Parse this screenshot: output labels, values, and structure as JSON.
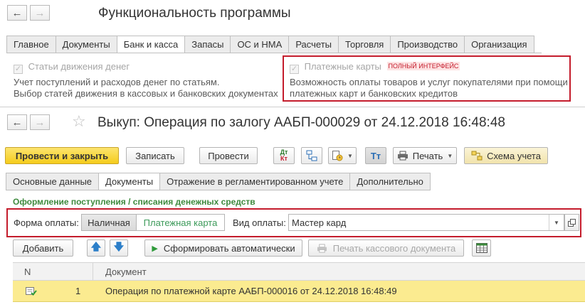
{
  "top_window": {
    "title": "Функциональность программы",
    "tabs": [
      "Главное",
      "Документы",
      "Банк и касса",
      "Запасы",
      "ОС и НМА",
      "Расчеты",
      "Торговля",
      "Производство",
      "Организация"
    ],
    "active_tab": "Банк и касса",
    "option_left": {
      "label": "Статьи движения денег",
      "checked": true,
      "desc_line1": "Учет поступлений и расходов денег по статьям.",
      "desc_line2": "Выбор статей движения в кассовых и банковских документах"
    },
    "option_right": {
      "label": "Платежные карты",
      "checked": true,
      "badge": "ПОЛНЫЙ ИНТЕРФЕЙС",
      "desc_line1": "Возможность оплаты товаров и услуг покупателями при помощи",
      "desc_line2": "платежных карт и банковских кредитов"
    }
  },
  "doc_window": {
    "title": "Выкуп: Операция по залогу ААБП-000029 от 24.12.2018 16:48:48",
    "toolbar": {
      "post_close": "Провести и закрыть",
      "save": "Записать",
      "post": "Провести",
      "dtkt_top": "Дт",
      "dtkt_bottom": "Кт",
      "print": "Печать",
      "schema": "Схема учета"
    },
    "tabs": [
      "Основные данные",
      "Документы",
      "Отражение в регламентированном учете",
      "Дополнительно"
    ],
    "active_tab": "Документы",
    "section_title": "Оформление поступления / списания денежных средств",
    "payment_form_label": "Форма оплаты:",
    "payment_form_options": [
      "Наличная",
      "Платежная карта"
    ],
    "payment_form_selected": "Платежная карта",
    "payment_type_label": "Вид оплаты:",
    "payment_type_value": "Мастер кард",
    "table_toolbar": {
      "add": "Добавить",
      "auto": "Сформировать автоматически",
      "print_cash": "Печать кассового документа"
    },
    "columns": [
      "N",
      "Документ"
    ],
    "rows": [
      {
        "n": "1",
        "doc": "Операция по платежной карте ААБП-000016 от 24.12.2018 16:48:49"
      }
    ]
  },
  "colors": {
    "highlight": "#c41c2c",
    "primary_button": "#f5cc1c",
    "selected_row": "#fbeb90",
    "section_title": "#3d8a3d"
  }
}
